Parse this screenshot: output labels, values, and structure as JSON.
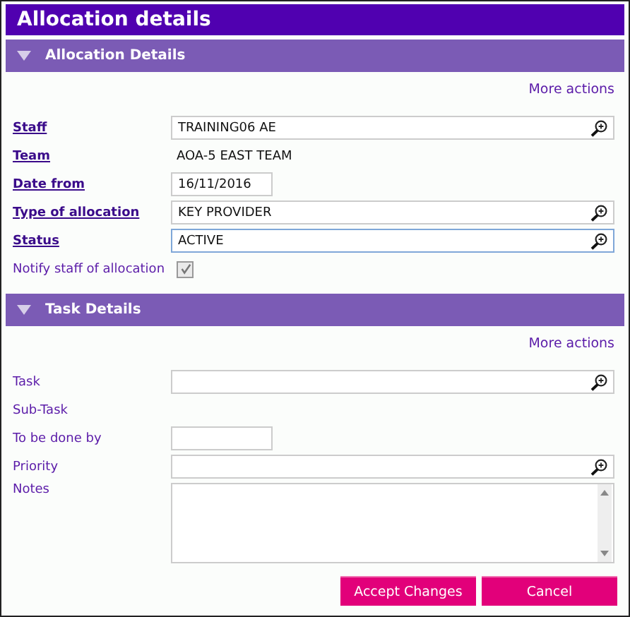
{
  "window": {
    "title": "Allocation details"
  },
  "sections": [
    {
      "title": "Allocation Details",
      "expanded": true,
      "more_actions": "More actions",
      "rows": [
        {
          "label": "Staff",
          "label_link": true,
          "kind": "lookup",
          "value": "TRAINING06 AE",
          "focused": false
        },
        {
          "label": "Team",
          "label_link": true,
          "kind": "text",
          "value": "AOA-5 EAST TEAM"
        },
        {
          "label": "Date from",
          "label_link": true,
          "kind": "date",
          "value": "16/11/2016",
          "focused": false
        },
        {
          "label": "Type of allocation",
          "label_link": true,
          "kind": "lookup",
          "value": "KEY PROVIDER",
          "focused": false
        },
        {
          "label": "Status",
          "label_link": true,
          "kind": "lookup",
          "value": "ACTIVE",
          "focused": true
        },
        {
          "label": "Notify staff of allocation",
          "label_link": false,
          "kind": "checkbox",
          "checked": true,
          "disabled": true
        }
      ]
    },
    {
      "title": "Task Details",
      "expanded": true,
      "more_actions": "More actions",
      "rows": [
        {
          "label": "Task",
          "label_link": false,
          "kind": "lookup",
          "focused": false
        },
        {
          "label": "Sub-Task",
          "label_link": false,
          "kind": "text"
        },
        {
          "label": "To be done by",
          "label_link": false,
          "kind": "date",
          "focused": false
        },
        {
          "label": "Priority",
          "label_link": false,
          "kind": "lookup",
          "focused": false
        },
        {
          "label": "Notes",
          "label_link": false,
          "kind": "textarea",
          "focused": false
        }
      ]
    }
  ],
  "buttons": [
    "Accept Changes",
    "Cancel"
  ]
}
